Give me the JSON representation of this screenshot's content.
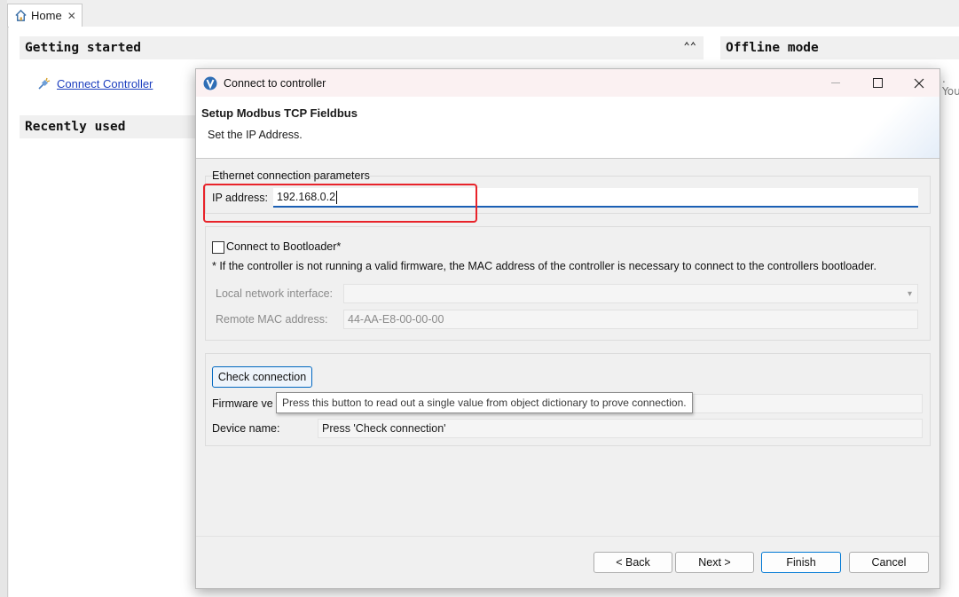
{
  "workbench": {
    "tab_label": "Home",
    "getting_started": "Getting started",
    "connect_link": "Connect Controller",
    "recently_used": "Recently used",
    "offline_mode": "Offline mode",
    "partial_text": ". You"
  },
  "dialog": {
    "title": "Connect to controller",
    "heading": "Setup Modbus TCP Fieldbus",
    "subheading": "Set the IP Address.",
    "ethernet_group_title": "Ethernet connection parameters",
    "ip_label": "IP address:",
    "ip_value": "192.168.0.2",
    "bootloader_checkbox_label": "Connect to Bootloader*",
    "bootloader_checked": false,
    "bootloader_note": "* If the controller is not running a valid firmware, the MAC address of the controller is necessary to connect to the controllers bootloader.",
    "local_iface_label": "Local network interface:",
    "local_iface_value": "",
    "remote_mac_label": "Remote MAC address:",
    "remote_mac_value": "44-AA-E8-00-00-00",
    "check_button": "Check connection",
    "firmware_label": "Firmware ve",
    "firmware_value": "",
    "device_label": "Device name:",
    "device_value": "Press 'Check connection'",
    "tooltip": "Press this button to read out a single value from object dictionary to prove connection.",
    "back_label": "< Back",
    "next_label": "Next >",
    "finish_label": "Finish",
    "cancel_label": "Cancel"
  },
  "colors": {
    "link": "#1d3fbf",
    "highlight": "#e8232a",
    "focus": "#0078d4",
    "titlebar": "#fbf1f2"
  }
}
